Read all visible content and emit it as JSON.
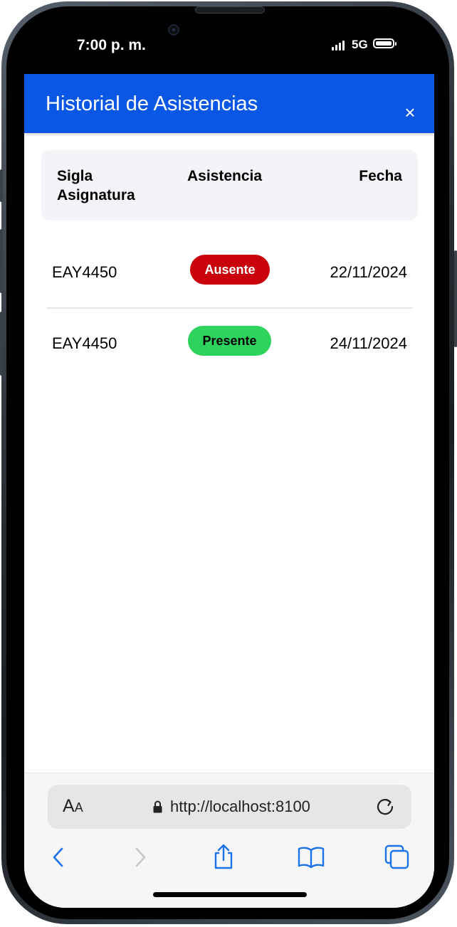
{
  "status_bar": {
    "time": "7:00 p. m.",
    "network": "5G"
  },
  "modal": {
    "title": "Historial de Asistencias",
    "close_label": "×",
    "table": {
      "headers": {
        "code": "Sigla Asignatura",
        "attendance": "Asistencia",
        "date": "Fecha"
      },
      "rows": [
        {
          "code": "EAY4450",
          "status": "Ausente",
          "status_color": "#c8010a",
          "status_text_color": "#ffffff",
          "date": "22/11/2024"
        },
        {
          "code": "EAY4450",
          "status": "Presente",
          "status_color": "#2dd35c",
          "status_text_color": "#000000",
          "date": "24/11/2024"
        }
      ]
    }
  },
  "browser": {
    "text_size_label": "AA",
    "url": "http://localhost:8100",
    "icons": [
      "back-icon",
      "forward-icon",
      "share-icon",
      "bookmarks-icon",
      "tabs-icon",
      "reload-icon",
      "lock-icon"
    ]
  },
  "colors": {
    "header": "#0a57e6",
    "ios_blue": "#1a73e8"
  }
}
